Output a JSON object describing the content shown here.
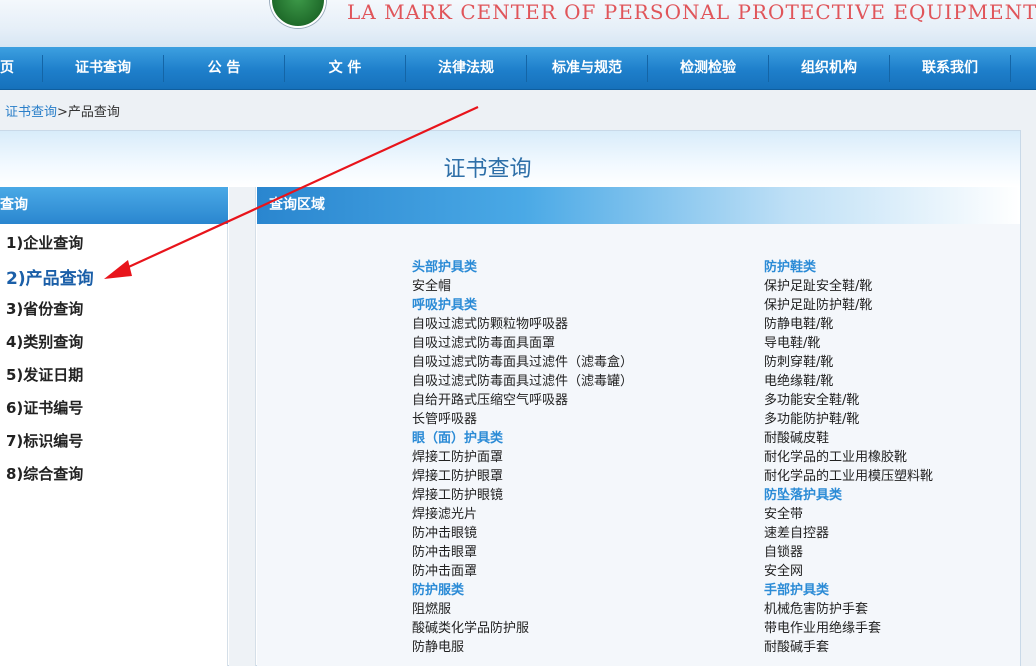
{
  "banner": {
    "text": "LA MARK CENTER OF PERSONAL PROTECTIVE EQUIPMENT"
  },
  "nav": {
    "items": [
      "页",
      "证书查询",
      "公 告",
      "文 件",
      "法律法规",
      "标准与规范",
      "检测检验",
      "组织机构",
      "联系我们"
    ]
  },
  "breadcrumb": {
    "link": "证书查询",
    "separator": ">",
    "current": "产品查询"
  },
  "panel": {
    "title": "证书查询"
  },
  "sidebar": {
    "header": "查询",
    "items": [
      "1)企业查询",
      "2)产品查询",
      "3)省份查询",
      "4)类别查询",
      "5)发证日期",
      "6)证书编号",
      "7)标识编号",
      "8)综合查询"
    ],
    "active_index": 1
  },
  "main": {
    "header": "查询区域"
  },
  "left_column": [
    {
      "text": "头部护具类",
      "category": true
    },
    {
      "text": "安全帽",
      "category": false
    },
    {
      "text": "呼吸护具类",
      "category": true
    },
    {
      "text": "自吸过滤式防颗粒物呼吸器",
      "category": false
    },
    {
      "text": "自吸过滤式防毒面具面罩",
      "category": false
    },
    {
      "text": "自吸过滤式防毒面具过滤件（滤毒盒）",
      "category": false
    },
    {
      "text": "自吸过滤式防毒面具过滤件（滤毒罐）",
      "category": false
    },
    {
      "text": "自给开路式压缩空气呼吸器",
      "category": false
    },
    {
      "text": "长管呼吸器",
      "category": false
    },
    {
      "text": "眼（面）护具类",
      "category": true
    },
    {
      "text": "焊接工防护面罩",
      "category": false
    },
    {
      "text": "焊接工防护眼罩",
      "category": false
    },
    {
      "text": "焊接工防护眼镜",
      "category": false
    },
    {
      "text": "焊接滤光片",
      "category": false
    },
    {
      "text": "防冲击眼镜",
      "category": false
    },
    {
      "text": "防冲击眼罩",
      "category": false
    },
    {
      "text": "防冲击面罩",
      "category": false
    },
    {
      "text": "防护服类",
      "category": true
    },
    {
      "text": "阻燃服",
      "category": false
    },
    {
      "text": "酸碱类化学品防护服",
      "category": false
    },
    {
      "text": "防静电服",
      "category": false
    }
  ],
  "right_column": [
    {
      "text": "防护鞋类",
      "category": true
    },
    {
      "text": "保护足趾安全鞋/靴",
      "category": false
    },
    {
      "text": "保护足趾防护鞋/靴",
      "category": false
    },
    {
      "text": "防静电鞋/靴",
      "category": false
    },
    {
      "text": "导电鞋/靴",
      "category": false
    },
    {
      "text": "防刺穿鞋/靴",
      "category": false
    },
    {
      "text": "电绝缘鞋/靴",
      "category": false
    },
    {
      "text": "多功能安全鞋/靴",
      "category": false
    },
    {
      "text": "多功能防护鞋/靴",
      "category": false
    },
    {
      "text": "耐酸碱皮鞋",
      "category": false
    },
    {
      "text": "耐化学品的工业用橡胶靴",
      "category": false
    },
    {
      "text": "耐化学品的工业用模压塑料靴",
      "category": false
    },
    {
      "text": "防坠落护具类",
      "category": true
    },
    {
      "text": "安全带",
      "category": false
    },
    {
      "text": "速差自控器",
      "category": false
    },
    {
      "text": "自锁器",
      "category": false
    },
    {
      "text": "安全网",
      "category": false
    },
    {
      "text": "手部护具类",
      "category": true
    },
    {
      "text": "机械危害防护手套",
      "category": false
    },
    {
      "text": "带电作业用绝缘手套",
      "category": false
    },
    {
      "text": "耐酸碱手套",
      "category": false
    }
  ],
  "colors": {
    "accent": "#2b8bd6",
    "nav": "#1e7fcb",
    "annotation_arrow": "#e8141b"
  }
}
